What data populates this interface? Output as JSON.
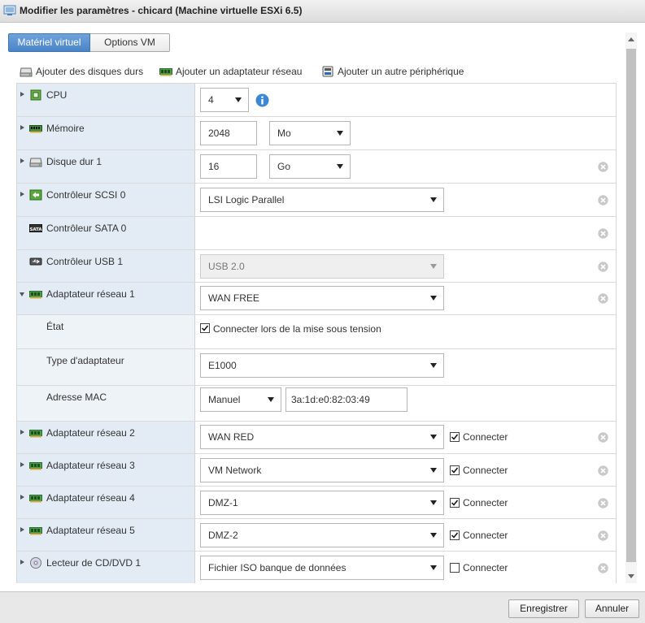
{
  "window": {
    "title": "Modifier les paramètres - chicard (Machine virtuelle ESXi 6.5)"
  },
  "tabs": [
    {
      "label": "Matériel virtuel",
      "active": true
    },
    {
      "label": "Options VM",
      "active": false
    }
  ],
  "toolbar": {
    "add_disk": "Ajouter des disques durs",
    "add_network": "Ajouter un adaptateur réseau",
    "add_other": "Ajouter un autre périphérique"
  },
  "rows": {
    "cpu": {
      "label": "CPU",
      "value": "4"
    },
    "memory": {
      "label": "Mémoire",
      "value": "2048",
      "unit": "Mo"
    },
    "disk1": {
      "label": "Disque dur 1",
      "value": "16",
      "unit": "Go"
    },
    "scsi0": {
      "label": "Contrôleur SCSI 0",
      "value": "LSI Logic Parallel"
    },
    "sata0": {
      "label": "Contrôleur SATA 0"
    },
    "usb1": {
      "label": "Contrôleur USB 1",
      "value": "USB 2.0"
    },
    "net1": {
      "label": "Adaptateur réseau 1",
      "value": "WAN FREE",
      "state_label": "État",
      "connect_on_power": "Connecter lors de la mise sous tension",
      "connect_on_power_checked": true,
      "type_label": "Type d'adaptateur",
      "type_value": "E1000",
      "mac_label": "Adresse MAC",
      "mac_mode": "Manuel",
      "mac_value": "3a:1d:e0:82:03:49"
    },
    "net2": {
      "label": "Adaptateur réseau 2",
      "value": "WAN RED",
      "connect": "Connecter",
      "checked": true
    },
    "net3": {
      "label": "Adaptateur réseau 3",
      "value": "VM Network",
      "connect": "Connecter",
      "checked": true
    },
    "net4": {
      "label": "Adaptateur réseau 4",
      "value": "DMZ-1",
      "connect": "Connecter",
      "checked": true
    },
    "net5": {
      "label": "Adaptateur réseau 5",
      "value": "DMZ-2",
      "connect": "Connecter",
      "checked": true
    },
    "cdrom1": {
      "label": "Lecteur de CD/DVD 1",
      "value": "Fichier ISO banque de données",
      "connect": "Connecter",
      "checked": false
    }
  },
  "footer": {
    "save": "Enregistrer",
    "cancel": "Annuler"
  },
  "colors": {
    "accent": "#4a84c6",
    "label_column": "#e3ecf4"
  }
}
